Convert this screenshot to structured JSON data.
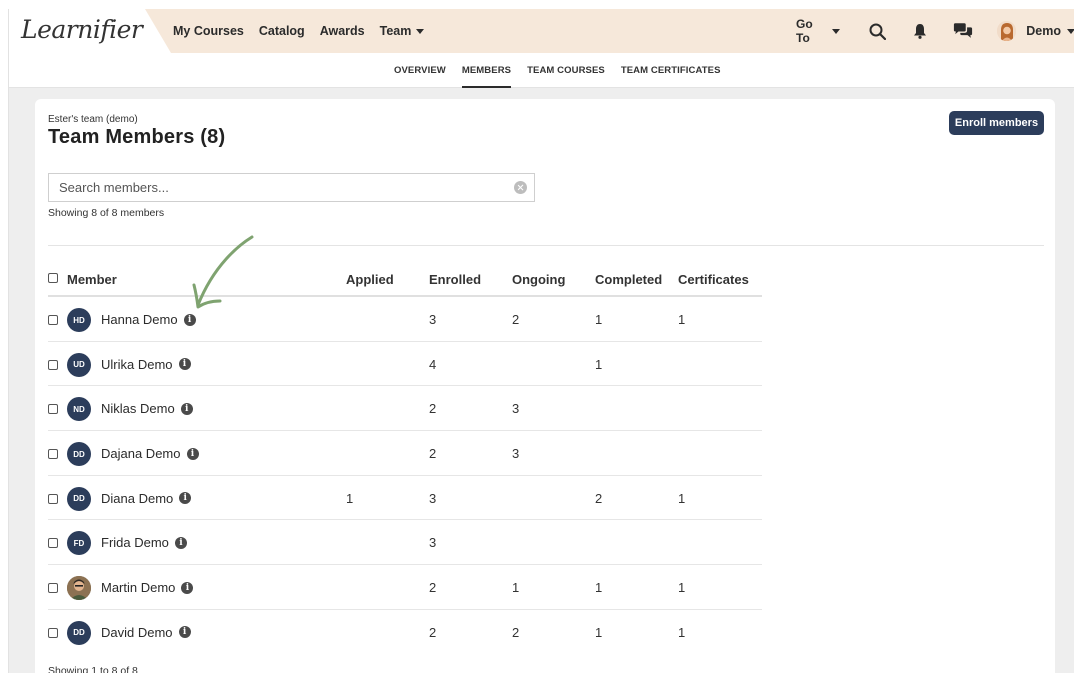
{
  "nav": {
    "logo": "Learnifier",
    "links": [
      "My Courses",
      "Catalog",
      "Awards"
    ],
    "team": "Team",
    "goto": "Go To",
    "user": "Demo"
  },
  "subnav": {
    "tabs": [
      "OVERVIEW",
      "MEMBERS",
      "TEAM COURSES",
      "TEAM CERTIFICATES"
    ],
    "active": "MEMBERS"
  },
  "page": {
    "team_name": "Ester's team (demo)",
    "title": "Team Members (8)",
    "enroll_button": "Enroll members",
    "search_placeholder": "Search members...",
    "showing_top": "Showing 8 of 8 members",
    "showing_bottom": "Showing 1 to 8 of 8"
  },
  "table": {
    "columns": [
      "Member",
      "Applied",
      "Enrolled",
      "Ongoing",
      "Completed",
      "Certificates"
    ],
    "rows": [
      {
        "initials": "HD",
        "name": "Hanna Demo",
        "applied": "",
        "enrolled": "3",
        "ongoing": "2",
        "completed": "1",
        "certificates": "1"
      },
      {
        "initials": "UD",
        "name": "Ulrika Demo",
        "applied": "",
        "enrolled": "4",
        "ongoing": "",
        "completed": "1",
        "certificates": ""
      },
      {
        "initials": "ND",
        "name": "Niklas Demo",
        "applied": "",
        "enrolled": "2",
        "ongoing": "3",
        "completed": "",
        "certificates": ""
      },
      {
        "initials": "DD",
        "name": "Dajana Demo",
        "applied": "",
        "enrolled": "2",
        "ongoing": "3",
        "completed": "",
        "certificates": ""
      },
      {
        "initials": "DD",
        "name": "Diana Demo",
        "applied": "1",
        "enrolled": "3",
        "ongoing": "",
        "completed": "2",
        "certificates": "1"
      },
      {
        "initials": "FD",
        "name": "Frida Demo",
        "applied": "",
        "enrolled": "3",
        "ongoing": "",
        "completed": "",
        "certificates": ""
      },
      {
        "initials": "",
        "name": "Martin Demo",
        "applied": "",
        "enrolled": "2",
        "ongoing": "1",
        "completed": "1",
        "certificates": "1",
        "photo": true
      },
      {
        "initials": "DD",
        "name": "David Demo",
        "applied": "",
        "enrolled": "2",
        "ongoing": "2",
        "completed": "1",
        "certificates": "1"
      }
    ]
  },
  "colors": {
    "topbar": "#f6e8da",
    "accent": "#2c3d5b",
    "arrow": "#7fa370"
  },
  "icons": [
    "search-icon",
    "bell-icon",
    "chat-icon",
    "info-icon",
    "clear-icon",
    "arrow-annotation"
  ]
}
